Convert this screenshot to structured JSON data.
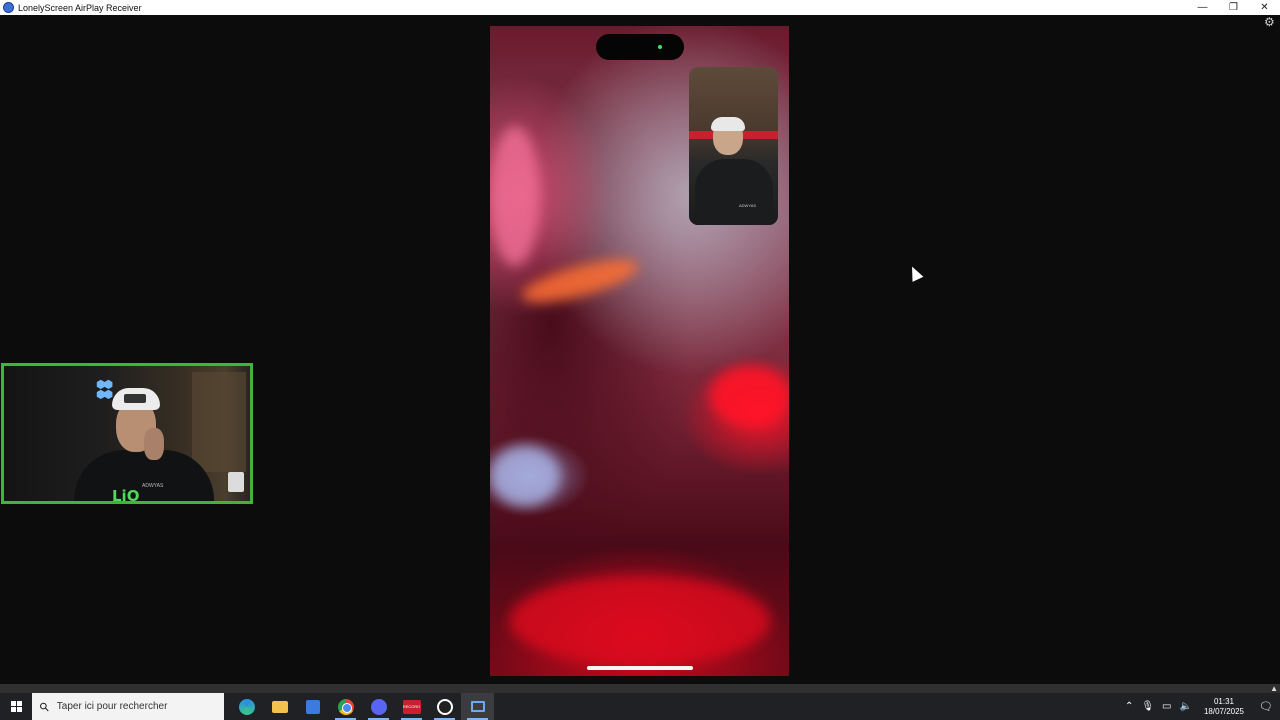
{
  "window": {
    "title": "LonelyScreen AirPlay Receiver",
    "controls": {
      "minimize": "—",
      "restore": "❐",
      "close": "✕"
    },
    "settings_icon": "gear-icon"
  },
  "overlay": {
    "shirt_text": "ADWYAS",
    "logo_text": "LiO"
  },
  "taskbar": {
    "search_placeholder": "Taper ici pour rechercher",
    "record_label": "RECORD",
    "apps": [
      "edge-icon",
      "file-explorer-icon",
      "store-icon",
      "chrome-icon",
      "discord-icon",
      "recorder-icon",
      "obs-icon",
      "screen-mirror-icon"
    ],
    "clock_time": "01:31",
    "clock_date": "18/07/2025"
  },
  "colors": {
    "webcam_border": "#3fb53a",
    "taskbar_bg": "#1f2124",
    "accent": "#7fb4f5"
  }
}
